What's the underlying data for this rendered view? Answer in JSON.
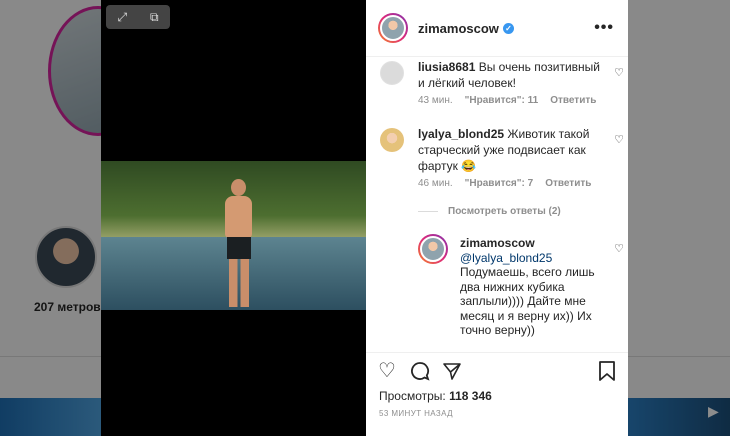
{
  "background": {
    "highlight_label": "207 метров"
  },
  "post": {
    "username": "zimamoscow",
    "verified": true,
    "views_label": "Просмотры:",
    "views_count": "118 346",
    "time_ago": "53 минут назад"
  },
  "comments": [
    {
      "username": "liusia8681",
      "text": "Вы очень позитивный и лёгкий человек!",
      "time": "43 мин.",
      "likes": "\"Нравится\": 11",
      "reply_label": "Ответить"
    },
    {
      "username": "lyalya_blond25",
      "text": "Животик такой старческий уже подвисает как фартук 😂",
      "time": "46 мин.",
      "likes": "\"Нравится\": 7",
      "reply_label": "Ответить"
    }
  ],
  "view_replies": "Посмотреть ответы (2)",
  "reply": {
    "username": "zimamoscow",
    "mention": "@lyalya_blond25",
    "text": "Подумаешь, всего лишь два нижних кубика заплыли)))) Дайте мне месяц и я верну их)) Их точно верну))"
  },
  "icons": {
    "expand": "expand-icon",
    "pip": "picture-in-picture-icon",
    "more": "more-icon",
    "heart": "heart-icon",
    "comment": "comment-icon",
    "share": "share-icon",
    "bookmark": "bookmark-icon",
    "verified": "verified-badge-icon"
  },
  "colors": {
    "verified": "#3897f0",
    "mention": "#00376b",
    "meta_text": "#8e8e8e"
  }
}
